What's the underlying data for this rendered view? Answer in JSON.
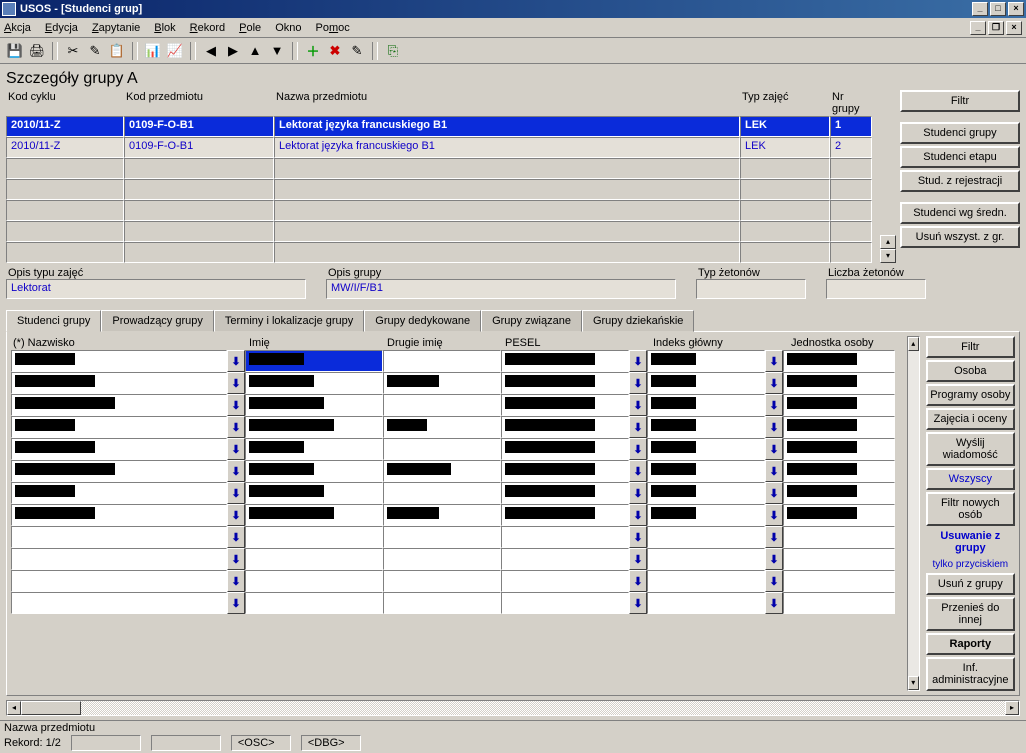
{
  "window": {
    "title": "USOS - [Studenci grup]"
  },
  "menu": {
    "akcja": "Akcja",
    "edycja": "Edycja",
    "zapytanie": "Zapytanie",
    "blok": "Blok",
    "rekord": "Rekord",
    "pole": "Pole",
    "okno": "Okno",
    "pomoc": "Pomoc"
  },
  "section": {
    "title": "Szczegóły grupy  A"
  },
  "grid": {
    "headers": {
      "cykl": "Kod cyklu",
      "przedmiot": "Kod przedmiotu",
      "nazwa": "Nazwa przedmiotu",
      "typ": "Typ zajęć",
      "nr": "Nr grupy"
    },
    "rows": [
      {
        "cykl": "2010/11-Z",
        "przedmiot": "0109-F-O-B1",
        "nazwa": "Lektorat języka francuskiego B1",
        "typ": "LEK",
        "nr": "1"
      },
      {
        "cykl": "2010/11-Z",
        "przedmiot": "0109-F-O-B1",
        "nazwa": "Lektorat języka francuskiego B1",
        "typ": "LEK",
        "nr": "2"
      }
    ]
  },
  "sidebuttons": {
    "filtr": "Filtr",
    "studenci_grupy": "Studenci grupy",
    "studenci_etapu": "Studenci etapu",
    "stud_rejestracji": "Stud. z rejestracji",
    "studenci_sredn": "Studenci wg średn.",
    "usun_wszyst": "Usuń wszyst. z gr."
  },
  "details": {
    "opis_typu_l": "Opis typu zajęć",
    "opis_typu_v": "Lektorat",
    "opis_grupy_l": "Opis grupy",
    "opis_grupy_v": "MW/I/F/B1",
    "typ_zetonow_l": "Typ żetonów",
    "typ_zetonow_v": "",
    "liczba_zetonow_l": "Liczba żetonów",
    "liczba_zetonow_v": ""
  },
  "tabs": {
    "studenci": "Studenci grupy",
    "prowadzacy": "Prowadzący grupy",
    "terminy": "Terminy i lokalizacje grupy",
    "dedykowane": "Grupy dedykowane",
    "zwiazane": "Grupy związane",
    "dziekanskie": "Grupy dziekańskie"
  },
  "students": {
    "headers": {
      "nazwisko": "(*) Nazwisko",
      "imie": "Imię",
      "drugie": "Drugie imię",
      "pesel": "PESEL",
      "indeks": "Indeks główny",
      "jednostka": "Jednostka osoby"
    },
    "rows_filled": 8,
    "rows_empty": 4
  },
  "sidebuttons2": {
    "filtr": "Filtr",
    "osoba": "Osoba",
    "programy": "Programy osoby",
    "zajecia": "Zajęcia i oceny",
    "wyslij": "Wyślij wiadomość",
    "wszyscy": "Wszyscy",
    "filtr_nowych": "Filtr nowych osób",
    "usuwanie_l1": "Usuwanie z grupy",
    "usuwanie_l2": "tylko przyciskiem",
    "usun": "Usuń z grupy",
    "przenies": "Przenieś do innej",
    "raporty": "Raporty",
    "inf": "Inf. administracyjne"
  },
  "status": {
    "line1": "Nazwa przedmiotu",
    "rekord": "Rekord: 1/2",
    "osc": "<OSC>",
    "dbg": "<DBG>"
  }
}
